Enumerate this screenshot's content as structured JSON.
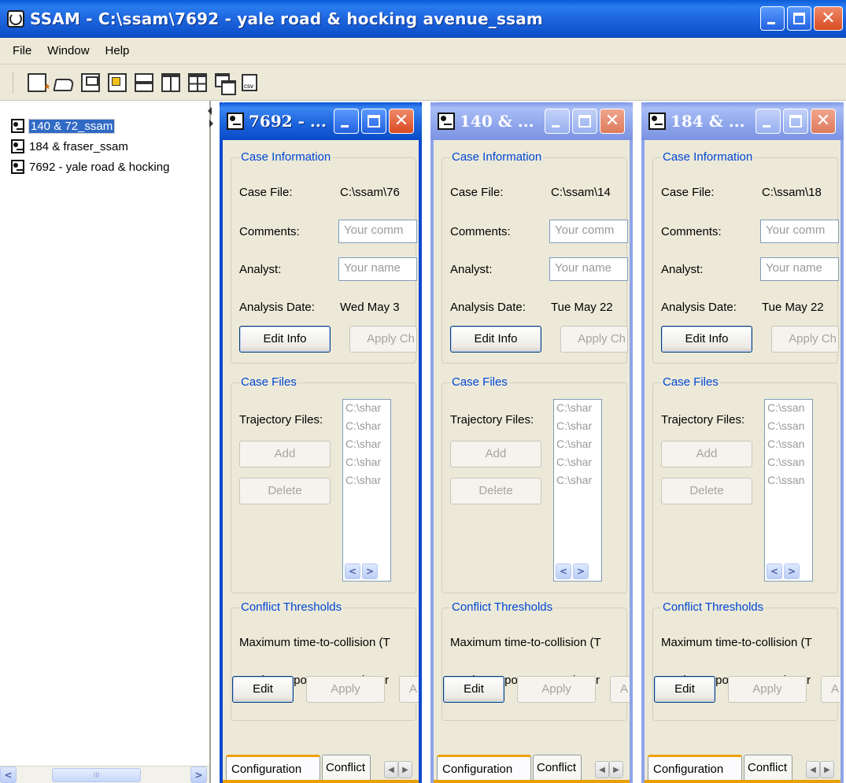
{
  "app": {
    "title": "SSAM - C:\\ssam\\7692 - yale road & hocking avenue_ssam",
    "close_glyph": "✕"
  },
  "menu": [
    "File",
    "Window",
    "Help"
  ],
  "toolbar": {
    "icons": [
      "new-icon",
      "open-icon",
      "save-icon",
      "tile-icon",
      "horizontal-split-icon",
      "vertical-split-icon",
      "grid-icon",
      "cascade-icon",
      "export-csv-icon"
    ]
  },
  "tree": {
    "items": [
      {
        "label": "140 & 72_ssam",
        "selected": true
      },
      {
        "label": "184 & fraser_ssam",
        "selected": false
      },
      {
        "label": "7692 - yale road & hocking",
        "selected": false
      }
    ],
    "scroll_left": "<",
    "scroll_grip": "III",
    "scroll_right": ">"
  },
  "common": {
    "case_info_title": "Case Information",
    "case_file_label": "Case File:",
    "comments_label": "Comments:",
    "analyst_label": "Analyst:",
    "analysis_date_label": "Analysis Date:",
    "edit_info_button": "Edit Info",
    "apply_changes_button": "Apply Ch",
    "case_files_title": "Case Files",
    "trajectory_files_label": "Trajectory Files:",
    "add_button": "Add",
    "delete_button": "Delete",
    "conflict_thresholds_title": "Conflict Thresholds",
    "max_ttc_label": "Maximum time-to-collision (T",
    "max_pet_label": "Maximum post-encroachmer",
    "edit_button": "Edit",
    "apply_button": "Apply",
    "third_button": "A",
    "configuration_tab": "Configuration",
    "conflicts_tab": "Conflict",
    "arrow_left": "<",
    "arrow_right": ">",
    "tab_left": "◀",
    "tab_right": "▶"
  },
  "windows": [
    {
      "title": "7692 - ...",
      "active": true,
      "case_file": "C:\\ssam\\76",
      "comments_placeholder": "Your comm",
      "analyst_placeholder": "Your name",
      "analysis_date": "Wed May 3",
      "trajectory_files": [
        "C:\\shar",
        "C:\\shar",
        "C:\\shar",
        "C:\\shar",
        "C:\\shar"
      ]
    },
    {
      "title": "140 & ...",
      "active": false,
      "case_file": "C:\\ssam\\14",
      "comments_placeholder": "Your comm",
      "analyst_placeholder": "Your name",
      "analysis_date": "Tue May 22",
      "trajectory_files": [
        "C:\\shar",
        "C:\\shar",
        "C:\\shar",
        "C:\\shar",
        "C:\\shar"
      ]
    },
    {
      "title": "184 & ...",
      "active": false,
      "case_file": "C:\\ssam\\18",
      "comments_placeholder": "Your comm",
      "analyst_placeholder": "Your name",
      "analysis_date": "Tue May 22",
      "trajectory_files": [
        "C:\\ssan",
        "C:\\ssan",
        "C:\\ssan",
        "C:\\ssan",
        "C:\\ssan"
      ]
    }
  ]
}
